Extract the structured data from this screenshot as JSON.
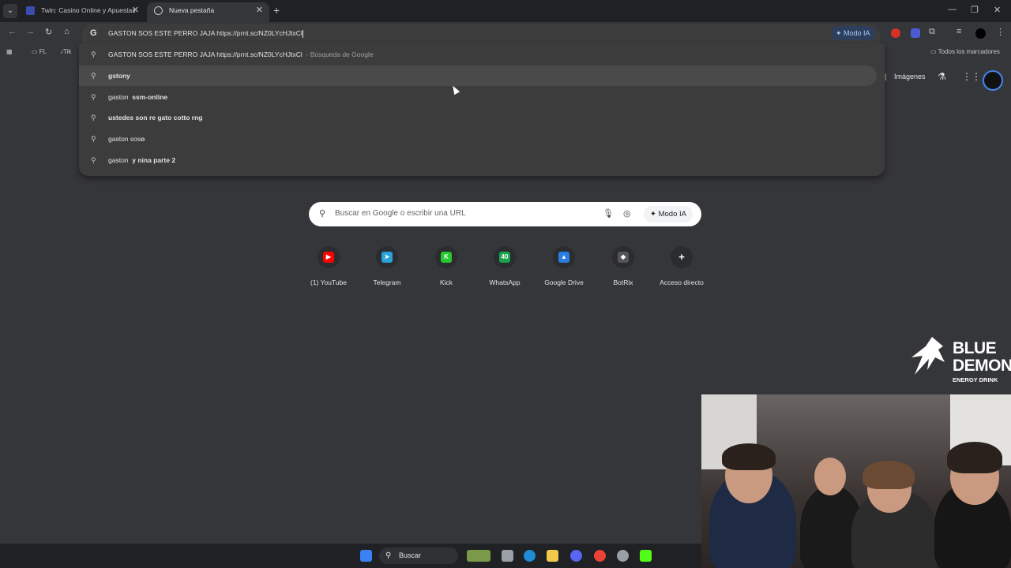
{
  "tabs": [
    {
      "title": "Twin: Casino Online y Apuestas"
    },
    {
      "title": "Nueva pestaña"
    }
  ],
  "omnibox": {
    "text": "GASTON SOS ESTE PERRO JAJA https://prnt.sc/NZ0LYcHJtxCl",
    "modo_ia": "Modo IA"
  },
  "bookmarks": {
    "fl": "FL",
    "tik": "Tik",
    "all": "Todos los marcadores"
  },
  "suggestions": [
    {
      "prefix": "",
      "bold": "",
      "text": "GASTON SOS ESTE PERRO JAJA https://prnt.sc/NZ0LYcHJtxCl",
      "sub": "- Búsqueda de Google"
    },
    {
      "prefix": "",
      "bold": "gstony",
      "text": "",
      "sub": ""
    },
    {
      "prefix": "gaston ",
      "bold": "ssm-online",
      "text": "",
      "sub": ""
    },
    {
      "prefix": "",
      "bold": "ustedes son re gato cotto rng",
      "text": "",
      "sub": ""
    },
    {
      "prefix": "gaston sos",
      "bold": "o",
      "text": "",
      "sub": ""
    },
    {
      "prefix": "gaston ",
      "bold": "y nina parte 2",
      "text": "",
      "sub": ""
    }
  ],
  "ntp": {
    "images_link": "Imágenes",
    "search_placeholder": "Buscar en Google o escribir una URL",
    "modo_ia": "Modo IA",
    "shortcuts": [
      {
        "label": "(1) YouTube",
        "icon": "youtube-icon",
        "glyph": "▶",
        "color": "#ff0000"
      },
      {
        "label": "Telegram",
        "icon": "telegram-icon",
        "glyph": "➤",
        "color": "#2aa3dc"
      },
      {
        "label": "Kick",
        "icon": "kick-icon",
        "glyph": "K",
        "color": "#24c92f"
      },
      {
        "label": "WhatsApp",
        "icon": "whatsapp-icon",
        "glyph": "40",
        "color": "#1aa34a"
      },
      {
        "label": "Google Drive",
        "icon": "google-drive-icon",
        "glyph": "▲",
        "color": "#2a7de1"
      },
      {
        "label": "BotRix",
        "icon": "botrix-icon",
        "glyph": "◆",
        "color": "#555555"
      },
      {
        "label": "Acceso directo",
        "icon": "plus-icon",
        "glyph": "+",
        "color": "#2b2c2f"
      }
    ]
  },
  "overlay": {
    "brand_title": "BLUE DEMON",
    "brand_sub": "ENERGY DRINK"
  },
  "taskbar": {
    "search_label": "Buscar"
  }
}
